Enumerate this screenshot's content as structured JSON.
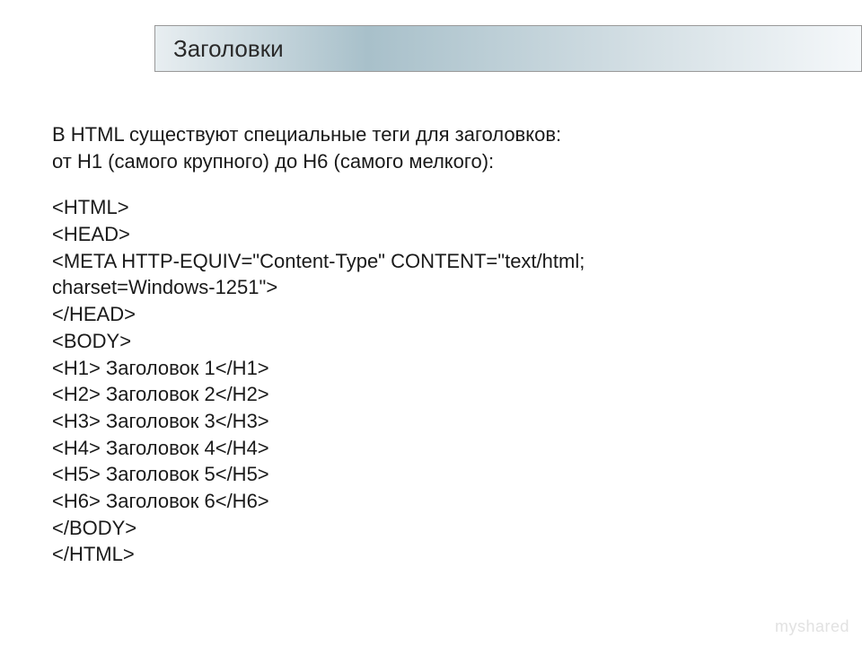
{
  "title": "Заголовки",
  "intro_line1": "В HTML существуют специальные теги для заголовков:",
  "intro_line2": "от H1 (самого крупного) до H6 (самого мелкого):",
  "code": {
    "l1": "<HTML>",
    "l2": "<HEAD>",
    "l3": "<META HTTP-EQUIV=\"Content-Type\" CONTENT=\"text/html;",
    "l4": "charset=Windows-1251\">",
    "l5": "</HEAD>",
    "l6": "<BODY>",
    "l7": "<H1> Заголовок 1</H1>",
    "l8": "<H2> Заголовок 2</H2>",
    "l9": "<H3> Заголовок 3</H3>",
    "l10": "<H4> Заголовок 4</H4>",
    "l11": "<H5> Заголовок 5</H5>",
    "l12": "<H6> Заголовок 6</H6>",
    "l13": "</BODY>",
    "l14": "</HTML>"
  },
  "watermark": "myshared"
}
